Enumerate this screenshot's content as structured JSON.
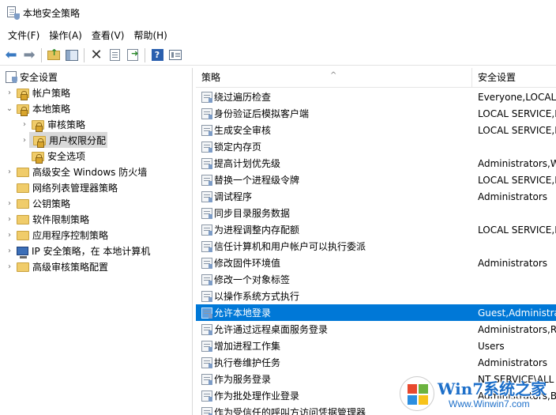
{
  "window": {
    "title": "本地安全策略"
  },
  "menu": [
    {
      "label": "文件(F)"
    },
    {
      "label": "操作(A)"
    },
    {
      "label": "查看(V)"
    },
    {
      "label": "帮助(H)"
    }
  ],
  "toolbar": {
    "icons": [
      "back-arrow-icon",
      "forward-arrow-icon",
      "up-folder-icon",
      "show-hide-tree-icon",
      "delete-icon",
      "properties-icon",
      "export-list-icon",
      "help-icon",
      "view-icon"
    ]
  },
  "tree": [
    {
      "label": "安全设置",
      "icon": "security-settings-icon",
      "expanded": true
    },
    {
      "label": "帐户策略",
      "icon": "folder-lock-icon",
      "expanded": false
    },
    {
      "label": "本地策略",
      "icon": "folder-lock-icon",
      "expanded": true
    },
    {
      "label": "审核策略",
      "icon": "folder-lock-icon",
      "expanded": false
    },
    {
      "label": "用户权限分配",
      "icon": "folder-lock-icon",
      "expanded": false,
      "selected": true
    },
    {
      "label": "安全选项",
      "icon": "folder-lock-icon",
      "expanded": false
    },
    {
      "label": "高级安全 Windows 防火墙",
      "icon": "folder-icon",
      "expanded": false
    },
    {
      "label": "网络列表管理器策略",
      "icon": "folder-icon",
      "expanded": false
    },
    {
      "label": "公钥策略",
      "icon": "folder-icon",
      "expanded": false
    },
    {
      "label": "软件限制策略",
      "icon": "folder-icon",
      "expanded": false
    },
    {
      "label": "应用程序控制策略",
      "icon": "folder-icon",
      "expanded": false
    },
    {
      "label": "IP 安全策略，在 本地计算机",
      "icon": "computer-icon",
      "expanded": false
    },
    {
      "label": "高级审核策略配置",
      "icon": "folder-icon",
      "expanded": false
    }
  ],
  "list": {
    "columns": {
      "policy": "策略",
      "setting": "安全设置"
    },
    "rows": [
      {
        "policy": "绕过遍历检查",
        "setting": "Everyone,LOCAL"
      },
      {
        "policy": "身份验证后模拟客户端",
        "setting": "LOCAL SERVICE,N"
      },
      {
        "policy": "生成安全审核",
        "setting": "LOCAL SERVICE,N"
      },
      {
        "policy": "锁定内存页",
        "setting": ""
      },
      {
        "policy": "提高计划优先级",
        "setting": "Administrators,W"
      },
      {
        "policy": "替换一个进程级令牌",
        "setting": "LOCAL SERVICE,N"
      },
      {
        "policy": "调试程序",
        "setting": "Administrators"
      },
      {
        "policy": "同步目录服务数据",
        "setting": ""
      },
      {
        "policy": "为进程调整内存配额",
        "setting": "LOCAL SERVICE,N"
      },
      {
        "policy": "信任计算机和用户帐户可以执行委派",
        "setting": ""
      },
      {
        "policy": "修改固件环境值",
        "setting": "Administrators"
      },
      {
        "policy": "修改一个对象标签",
        "setting": ""
      },
      {
        "policy": "以操作系统方式执行",
        "setting": ""
      },
      {
        "policy": "允许本地登录",
        "setting": "Guest,Administrat",
        "selected": true
      },
      {
        "policy": "允许通过远程桌面服务登录",
        "setting": "Administrators,Re"
      },
      {
        "policy": "增加进程工作集",
        "setting": "Users"
      },
      {
        "policy": "执行卷维护任务",
        "setting": "Administrators"
      },
      {
        "policy": "作为服务登录",
        "setting": "NT SERVICE\\ALL"
      },
      {
        "policy": "作为批处理作业登录",
        "setting": "Administrators,Ba"
      },
      {
        "policy": "作为受信任的呼叫方访问凭据管理器",
        "setting": ""
      }
    ]
  },
  "watermark": {
    "brand": "Win7系统之家",
    "url": "Www.Winwin7.com"
  }
}
